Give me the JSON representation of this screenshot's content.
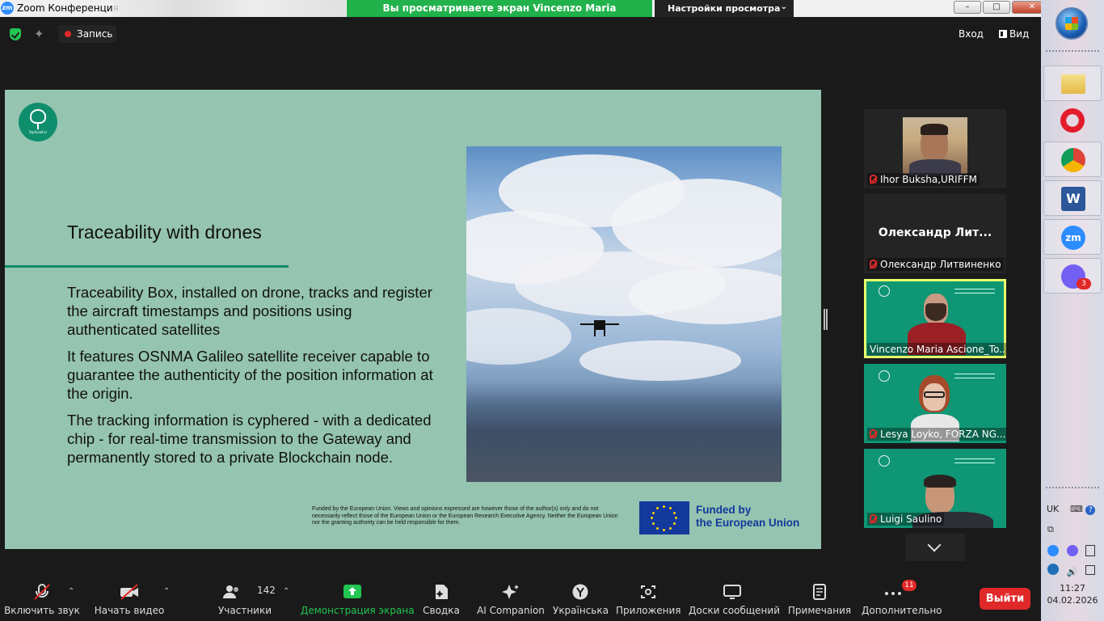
{
  "window": {
    "app_icon": "zm",
    "title": "Zoom Конференция",
    "share_banner": "Вы просматриваете экран Vincenzo Maria Ascione_TopView",
    "view_settings": "Настройки просмотра",
    "view_settings_chevron": "⌄"
  },
  "topbar": {
    "recording": "Запись",
    "exit": "Вход",
    "view": "Вид"
  },
  "slide": {
    "logo_text": "TopViewFor",
    "title": "Traceability with drones",
    "paragraphs": [
      "Traceability Box, installed on drone, tracks and register the aircraft timestamps and positions using authenticated satellites",
      "It features OSNMA Galileo satellite receiver capable to guarantee the authenticity of the position information at the origin.",
      "The tracking information is cyphered  - with a dedicated chip - for real-time transmission to the Gateway and permanently stored to a private Blockchain node."
    ],
    "funding_disclaimer": "Funded by the European Union. Views and opinions expressed are however those of the author(s) only and do not necessarily reflect those of the European Union or the European Research Executive Agency. Neither the European Union nor the granting authority can be held responsible for them.",
    "eu_line1": "Funded by",
    "eu_line2": "the European Union",
    "colors": {
      "background": "#95c4b0",
      "accent": "#0e8a6a",
      "eu_blue": "#12399b"
    }
  },
  "participants": [
    {
      "name": "Ihor Buksha,URIFFM",
      "muted": true,
      "video": "photo"
    },
    {
      "name": "Олександр Литвиненко",
      "display": "Олександр  Лит...",
      "muted": true,
      "video": "off"
    },
    {
      "name": "Vincenzo Maria Ascione_To...",
      "muted": false,
      "video": "camera",
      "active_speaker": true
    },
    {
      "name": "Lesya Loyko, FORZA NG...",
      "muted": true,
      "video": "camera"
    },
    {
      "name": "Luigi Saulino",
      "muted": true,
      "video": "camera"
    }
  ],
  "toolbar": {
    "mute": "Включить звук",
    "video": "Начать видео",
    "participants": "Участники",
    "participants_count": "142",
    "share": "Демонстрация экрана",
    "summary": "Сводка",
    "ai": "AI Companion",
    "language": "Українська",
    "apps": "Приложения",
    "whiteboards": "Доски сообщений",
    "notes": "Примечания",
    "more": "Дополнительно",
    "more_badge": "11",
    "leave": "Выйти",
    "share_color": "#23c552",
    "leave_color": "#e02828"
  },
  "taskbar": {
    "apps": [
      "explorer-icon",
      "opera-icon",
      "chrome-icon",
      "word-icon",
      "zoom-icon",
      "viber-icon"
    ],
    "zoom_glyph": "zm",
    "word_glyph": "W",
    "viber_badge": "3",
    "language": "UK",
    "time": "11:27",
    "date": "04.02.2026"
  }
}
